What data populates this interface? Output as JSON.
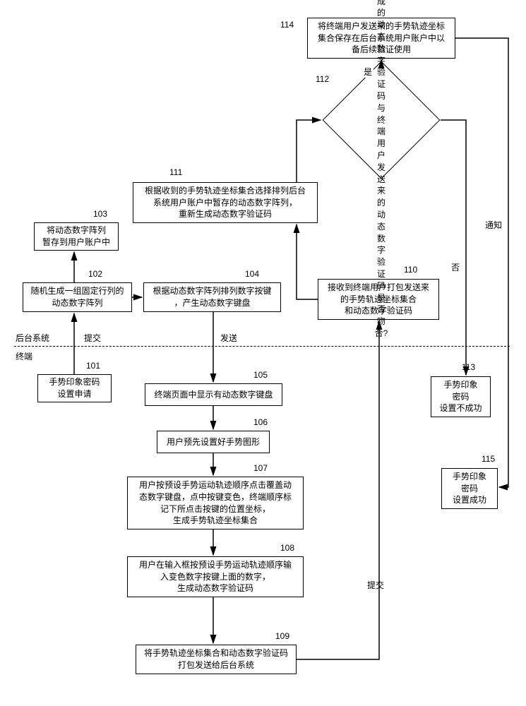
{
  "nodes": {
    "n101": {
      "num": "101",
      "text": "手势印象密码\n设置申请"
    },
    "n102": {
      "num": "102",
      "text": "随机生成一组固定行列的\n动态数字阵列"
    },
    "n103": {
      "num": "103",
      "text": "将动态数字阵列\n暂存到用户账户中"
    },
    "n104": {
      "num": "104",
      "text": "根据动态数字阵列排列数字按键\n，产生动态数字键盘"
    },
    "n105": {
      "num": "105",
      "text": "终端页面中显示有动态数字键盘"
    },
    "n106": {
      "num": "106",
      "text": "用户预先设置好手势图形"
    },
    "n107": {
      "num": "107",
      "text": "用户按预设手势运动轨迹顺序点击覆盖动\n态数字键盘，点中按键变色，终端顺序标\n记下所点击按键的位置坐标，\n生成手势轨迹坐标集合"
    },
    "n108": {
      "num": "108",
      "text": "用户在输入框按预设手势运动轨迹顺序输\n入变色数字按键上面的数字，\n生成动态数字验证码"
    },
    "n109": {
      "num": "109",
      "text": "将手势轨迹坐标集合和动态数字验证码\n打包发送给后台系统"
    },
    "n110": {
      "num": "110",
      "text": "接收到终端用户打包发送来\n的手势轨迹坐标集合\n和动态数字验证码"
    },
    "n111": {
      "num": "111",
      "text": "根据收到的手势轨迹坐标集合选择排列后台\n系统用户账户中暂存的动态数字阵列，\n重新生成动态数字验证码"
    },
    "n112": {
      "num": "112",
      "text": "比对后台系统新生成的动态\n数字验证码与终端用户发送\n来的动态数字验证码是否吻\n合?"
    },
    "n113": {
      "num": "113",
      "text": "手势印象\n密码\n设置不成功"
    },
    "n114": {
      "num": "114",
      "text": "将终端用户发送来的手势轨迹坐标\n集合保存在后台系统用户账户中以\n备后续验证使用"
    },
    "n115": {
      "num": "115",
      "text": "手势印象\n密码\n设置成功"
    }
  },
  "labels": {
    "submit1": "提交",
    "send": "发送",
    "submit2": "提交",
    "notify": "通知",
    "yes": "是",
    "no": "否",
    "backend": "后台系统",
    "terminal": "终端"
  }
}
